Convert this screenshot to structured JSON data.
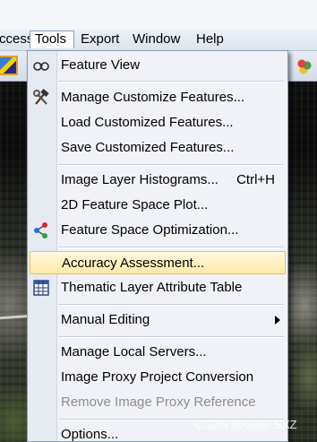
{
  "menubar": {
    "items": [
      {
        "label": "ccess",
        "active": false
      },
      {
        "label": "Tools",
        "active": true
      },
      {
        "label": "Export",
        "active": false
      },
      {
        "label": "Window",
        "active": false
      },
      {
        "label": "Help",
        "active": false
      }
    ]
  },
  "tools_menu": {
    "items": [
      {
        "label": "Feature View",
        "icon": "feature-view-icon",
        "enabled": true
      },
      {
        "label": "Manage Customize Features...",
        "icon": "tools-hammer-wrench-icon",
        "enabled": true
      },
      {
        "label": "Load Customized Features...",
        "enabled": true
      },
      {
        "label": "Save Customized Features...",
        "enabled": true
      },
      {
        "label": "Image Layer Histograms...",
        "shortcut": "Ctrl+H",
        "enabled": true
      },
      {
        "label": "2D Feature Space Plot...",
        "enabled": true
      },
      {
        "label": "Feature Space Optimization...",
        "icon": "feature-space-optimization-icon",
        "enabled": true
      },
      {
        "label": "Accuracy Assessment...",
        "highlighted": true,
        "enabled": true
      },
      {
        "label": "Thematic Layer Attribute Table",
        "icon": "table-icon",
        "enabled": true
      },
      {
        "label": "Manual Editing",
        "submenu": true,
        "enabled": true
      },
      {
        "label": "Manage Local Servers...",
        "enabled": true
      },
      {
        "label": "Image Proxy Project Conversion",
        "enabled": true
      },
      {
        "label": "Remove Image Proxy Reference",
        "enabled": false
      },
      {
        "label": "Options...",
        "enabled": true
      }
    ]
  },
  "watermark": "CSDN @Giser SXZ",
  "colors": {
    "highlight": "#fde9a8",
    "highlight_border": "#e8c15e",
    "menu_bg": "#f0f2f7",
    "disabled_text": "#8e8e8e"
  }
}
